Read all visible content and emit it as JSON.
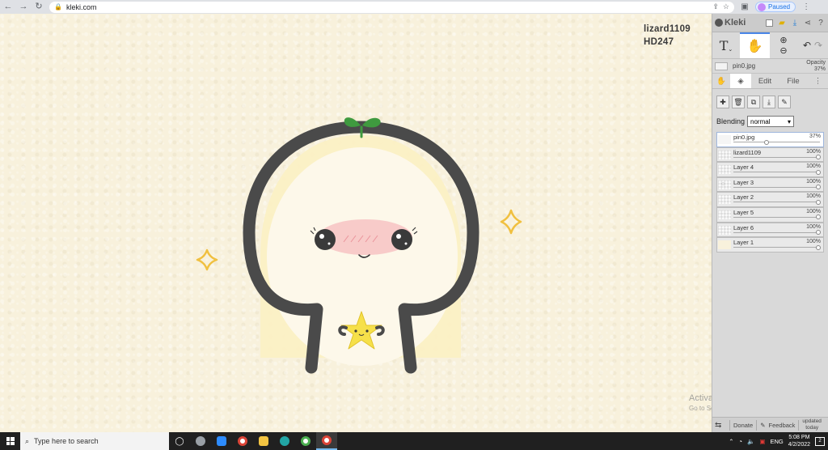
{
  "browser": {
    "url": "kleki.com",
    "profile_status": "Paused"
  },
  "canvas": {
    "signature_line1": "lizard1109",
    "signature_line2": "HD247",
    "colors": {
      "background": "#f8f1dc",
      "outline": "#4a4a4a",
      "sprout": "#3f9a3f",
      "fill": "#fbf0c4",
      "blush": "#f4a6ad",
      "star": "#f6e04a",
      "sparkle": "#f0c040"
    }
  },
  "watermark": {
    "title": "Activate Windows",
    "subtitle": "Go to Settings to activate Windows."
  },
  "panel": {
    "app_name": "Kleki",
    "current_layer": {
      "name": "pin0.jpg",
      "opacity_label": "Opacity",
      "opacity_value": "37%"
    },
    "tabs": {
      "edit": "Edit",
      "file": "File"
    },
    "blending_label": "Blending",
    "blending_value": "normal",
    "layers": [
      {
        "name": "pin0.jpg",
        "opacity": "37%",
        "level": 0.37,
        "selected": true,
        "hidden": false
      },
      {
        "name": "lizard1109",
        "opacity": "100%",
        "level": 1,
        "selected": false,
        "hidden": false
      },
      {
        "name": "Layer 4",
        "opacity": "100%",
        "level": 1,
        "selected": false,
        "hidden": false
      },
      {
        "name": "Layer 3",
        "opacity": "100%",
        "level": 1,
        "selected": false,
        "hidden": true
      },
      {
        "name": "Layer 2",
        "opacity": "100%",
        "level": 1,
        "selected": false,
        "hidden": false
      },
      {
        "name": "Layer 5",
        "opacity": "100%",
        "level": 1,
        "selected": false,
        "hidden": false
      },
      {
        "name": "Layer 6",
        "opacity": "100%",
        "level": 1,
        "selected": false,
        "hidden": false
      },
      {
        "name": "Layer 1",
        "opacity": "100%",
        "level": 1,
        "selected": false,
        "hidden": false
      }
    ],
    "footer": {
      "donate": "Donate",
      "feedback": "Feedback",
      "updated_line1": "updated",
      "updated_line2": "today"
    }
  },
  "taskbar": {
    "search_placeholder": "Type here to search",
    "language": "ENG",
    "time": "5:08 PM",
    "date": "4/2/2022",
    "notification_count": "2"
  }
}
